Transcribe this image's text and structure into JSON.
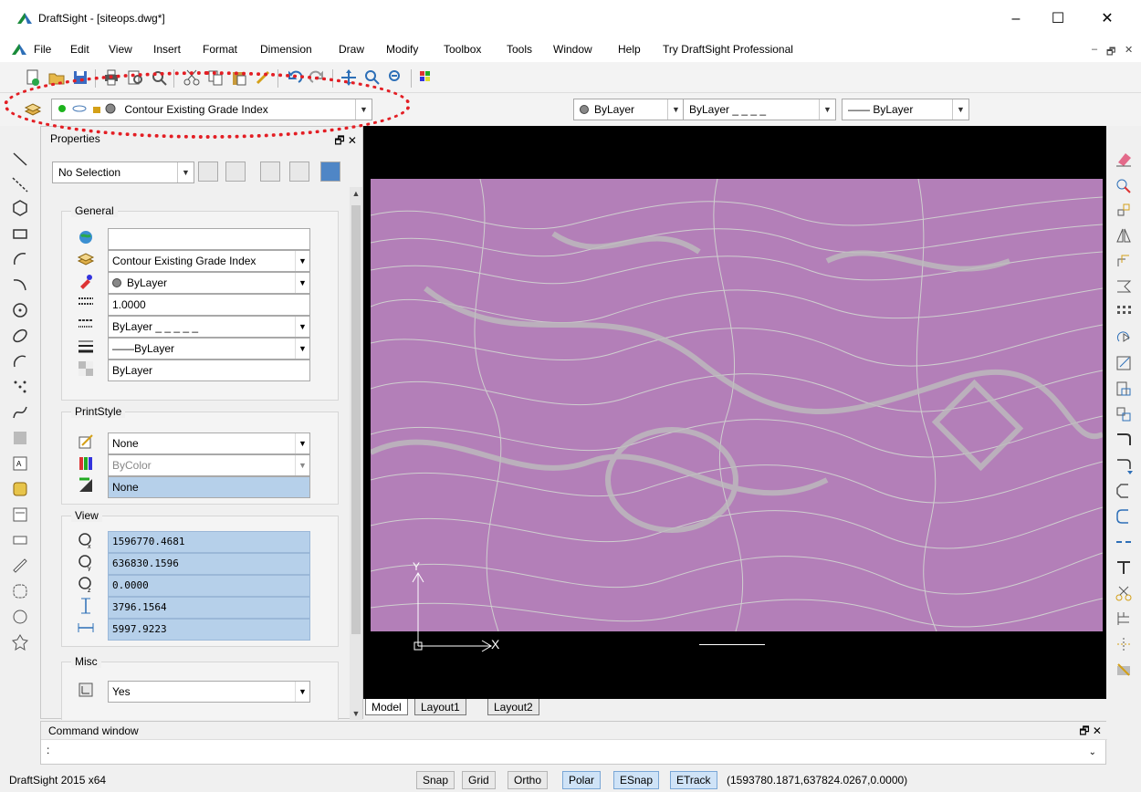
{
  "window": {
    "title": "DraftSight - [siteops.dwg*]",
    "minimize": "–",
    "maximize": "☐",
    "close": "✕"
  },
  "menu": {
    "items": [
      "File",
      "Edit",
      "View",
      "Insert",
      "Format",
      "Dimension",
      "Draw",
      "Modify",
      "Toolbox",
      "Tools",
      "Window",
      "Help",
      "Try DraftSight Professional"
    ],
    "mdi_minimize": "–",
    "mdi_restore": "🗗",
    "mdi_close": "✕"
  },
  "layer_toolbar": {
    "current_layer": "Contour Existing Grade Index",
    "color": "ByLayer",
    "linetype": "ByLayer _ _ _ _",
    "lineweight": "—— ByLayer"
  },
  "properties": {
    "title": "Properties",
    "selection": "No Selection",
    "general": {
      "title": "General",
      "color_field": "",
      "layer": "Contour Existing Grade Index",
      "color": "ByLayer",
      "linetype_scale": "1.0000",
      "linetype": "ByLayer _ _ _ _ _",
      "lineweight": "——ByLayer",
      "transparency": "ByLayer"
    },
    "printstyle": {
      "title": "PrintStyle",
      "style": "None",
      "by_color": "ByColor",
      "table": "None"
    },
    "view": {
      "title": "View",
      "center_x": "1596770.4681",
      "center_y": "636830.1596",
      "center_z": "0.0000",
      "height": "3796.1564",
      "width": "5997.9223"
    },
    "misc": {
      "title": "Misc",
      "ucs_icon": "Yes"
    }
  },
  "canvas": {
    "axis_x": "X",
    "axis_y": "Y",
    "tabs": [
      "Model",
      "Layout1",
      "Layout2"
    ],
    "map_color": "#b37fb8",
    "contour_color": "#cfcfcf"
  },
  "command": {
    "title": "Command window",
    "prompt": ":"
  },
  "status": {
    "app": "DraftSight 2015 x64",
    "buttons": [
      {
        "label": "Snap",
        "on": false
      },
      {
        "label": "Grid",
        "on": false
      },
      {
        "label": "Ortho",
        "on": false
      },
      {
        "label": "Polar",
        "on": true
      },
      {
        "label": "ESnap",
        "on": true
      },
      {
        "label": "ETrack",
        "on": true
      }
    ],
    "coordinates": "(1593780.1871,637824.0267,0.0000)"
  }
}
